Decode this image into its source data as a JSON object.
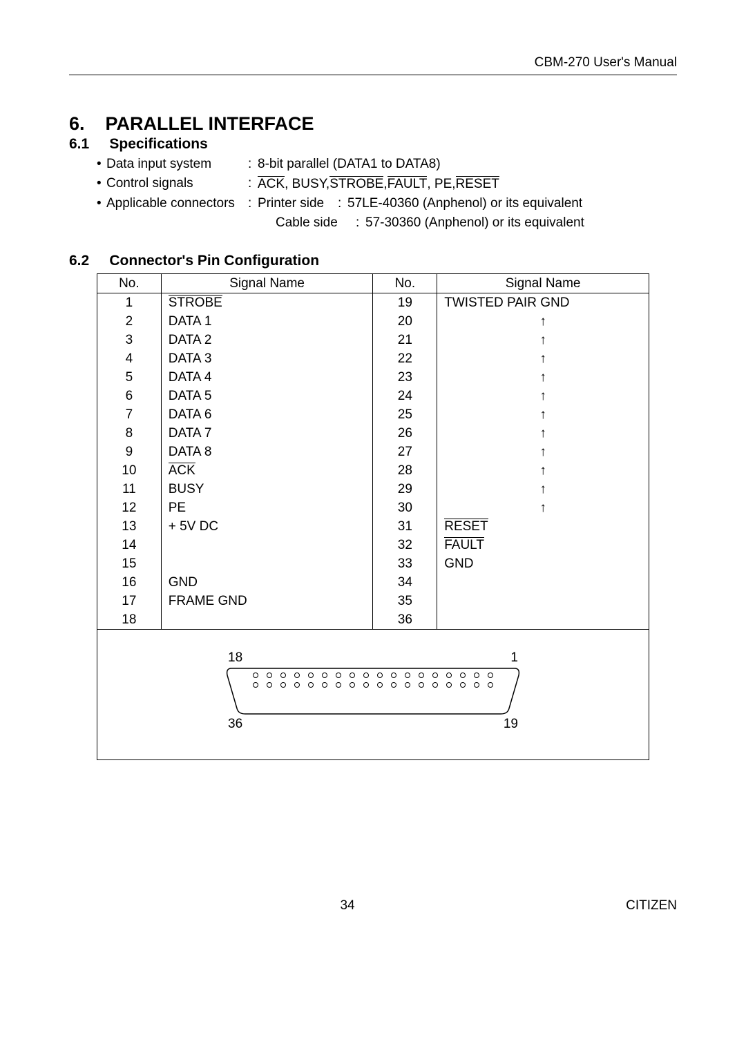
{
  "header": {
    "title": "CBM-270 User's Manual"
  },
  "section": {
    "num": "6.",
    "title": "PARALLEL INTERFACE"
  },
  "sub1": {
    "num": "6.1",
    "title": "Specifications"
  },
  "specs": {
    "row1": {
      "label": "Data input system",
      "value": "8-bit parallel (DATA1 to DATA8)"
    },
    "row2": {
      "label": "Control signals",
      "pre": "",
      "ack": "ACK",
      "sep1": ", BUSY, ",
      "strobe": "STROBE",
      "sep2": ", ",
      "fault": "FAULT",
      "sep3": ", PE, ",
      "reset": "RESET"
    },
    "row3": {
      "label": "Applicable connectors",
      "pslabel": "Printer side",
      "psval": "57LE-40360 (Anphenol) or its equivalent",
      "cslabel": "Cable side",
      "csval": "57-30360 (Anphenol) or its equivalent"
    }
  },
  "sub2": {
    "num": "6.2",
    "title": "Connector's Pin Configuration"
  },
  "tableHeaders": {
    "no": "No.",
    "sig": "Signal Name"
  },
  "pins": {
    "left": [
      {
        "no": "1",
        "sig": "STROBE",
        "over": true
      },
      {
        "no": "2",
        "sig": "DATA 1",
        "over": false
      },
      {
        "no": "3",
        "sig": "DATA 2",
        "over": false
      },
      {
        "no": "4",
        "sig": "DATA 3",
        "over": false
      },
      {
        "no": "5",
        "sig": "DATA 4",
        "over": false
      },
      {
        "no": "6",
        "sig": "DATA 5",
        "over": false
      },
      {
        "no": "7",
        "sig": "DATA 6",
        "over": false
      },
      {
        "no": "8",
        "sig": "DATA 7",
        "over": false
      },
      {
        "no": "9",
        "sig": "DATA 8",
        "over": false
      },
      {
        "no": "10",
        "sig": "ACK",
        "over": true
      },
      {
        "no": "11",
        "sig": "BUSY",
        "over": false
      },
      {
        "no": "12",
        "sig": "PE",
        "over": false
      },
      {
        "no": "13",
        "sig": "+ 5V DC",
        "over": false
      },
      {
        "no": "14",
        "sig": "",
        "over": false
      },
      {
        "no": "15",
        "sig": "",
        "over": false
      },
      {
        "no": "16",
        "sig": "GND",
        "over": false
      },
      {
        "no": "17",
        "sig": "FRAME GND",
        "over": false
      },
      {
        "no": "18",
        "sig": "",
        "over": false
      }
    ],
    "right": [
      {
        "no": "19",
        "sig": "TWISTED PAIR GND",
        "arrow": false,
        "over": false
      },
      {
        "no": "20",
        "sig": "↑",
        "arrow": true,
        "over": false
      },
      {
        "no": "21",
        "sig": "↑",
        "arrow": true,
        "over": false
      },
      {
        "no": "22",
        "sig": "↑",
        "arrow": true,
        "over": false
      },
      {
        "no": "23",
        "sig": "↑",
        "arrow": true,
        "over": false
      },
      {
        "no": "24",
        "sig": "↑",
        "arrow": true,
        "over": false
      },
      {
        "no": "25",
        "sig": "↑",
        "arrow": true,
        "over": false
      },
      {
        "no": "26",
        "sig": "↑",
        "arrow": true,
        "over": false
      },
      {
        "no": "27",
        "sig": "↑",
        "arrow": true,
        "over": false
      },
      {
        "no": "28",
        "sig": "↑",
        "arrow": true,
        "over": false
      },
      {
        "no": "29",
        "sig": "↑",
        "arrow": true,
        "over": false
      },
      {
        "no": "30",
        "sig": "↑",
        "arrow": true,
        "over": false
      },
      {
        "no": "31",
        "sig": "RESET",
        "arrow": false,
        "over": true
      },
      {
        "no": "32",
        "sig": "FAULT",
        "arrow": false,
        "over": true
      },
      {
        "no": "33",
        "sig": "GND",
        "arrow": false,
        "over": false
      },
      {
        "no": "34",
        "sig": "",
        "arrow": false,
        "over": false
      },
      {
        "no": "35",
        "sig": "",
        "arrow": false,
        "over": false
      },
      {
        "no": "36",
        "sig": "",
        "arrow": false,
        "over": false
      }
    ]
  },
  "diagram": {
    "tl": "18",
    "tr": "1",
    "bl": "36",
    "br": "19"
  },
  "footer": {
    "page": "34",
    "brand": "CITIZEN"
  }
}
